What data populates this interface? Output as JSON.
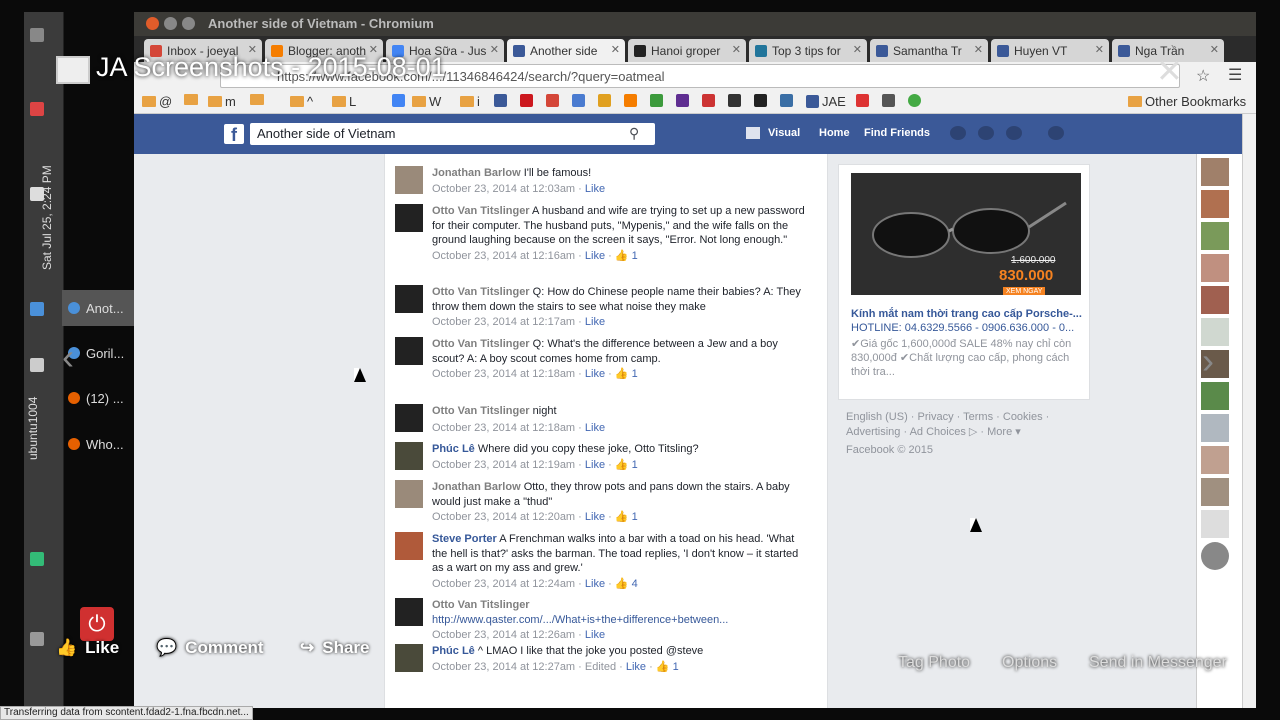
{
  "browser": {
    "window_title": "Another side of Vietnam - Chromium",
    "url": "https://www.facebook.com/.../11346846424/search/?query=oatmeal",
    "tabs": [
      {
        "label": "Inbox - joeyal",
        "color": "#d44638"
      },
      {
        "label": "Blogger: anoth",
        "color": "#f57d00"
      },
      {
        "label": "Hoa Sữa - Jus",
        "color": "#4285f4"
      },
      {
        "label": "Another side",
        "color": "#3b5998"
      },
      {
        "label": "Hanoi groper",
        "color": "#222222"
      },
      {
        "label": "Top 3 tips for",
        "color": "#21759b"
      },
      {
        "label": "Samantha Tr",
        "color": "#3b5998"
      },
      {
        "label": "Huyen VT",
        "color": "#3b5998"
      },
      {
        "label": "Nga Trần",
        "color": "#3b5998"
      }
    ],
    "bookmarks": [
      "@",
      "m",
      "^",
      "L",
      "W",
      "i",
      "JAE"
    ],
    "other_bookmarks": "Other Bookmarks",
    "status": "Transferring data from scontent.fdad2-1.fna.fbcdn.net..."
  },
  "desktop": {
    "clock": "Sat Jul 25, 2:24 PM",
    "user": "ubuntu1004",
    "tasks": [
      {
        "label": "Anot...",
        "color": "#4a90d9"
      },
      {
        "label": "Goril...",
        "color": "#4a90d9"
      },
      {
        "label": "(12) ...",
        "color": "#e66000"
      },
      {
        "label": "Who...",
        "color": "#e66000"
      }
    ]
  },
  "facebook": {
    "search_value": "Another side of Vietnam",
    "nav": {
      "visual": "Visual",
      "home": "Home",
      "find_friends": "Find Friends"
    },
    "comments": [
      {
        "author": "Jonathan Barlow",
        "verified": true,
        "text": "I'll be famous!",
        "meta": "October 23, 2014 at 12:03am",
        "like": "Like",
        "likes": ""
      },
      {
        "author": "Otto Van Titslinger",
        "verified": true,
        "text": "A husband and wife are trying to set up a new password for their computer. The husband puts, \"Mypenis,\" and the wife falls on the ground laughing because on the screen it says, \"Error. Not long enough.\"",
        "meta": "October 23, 2014 at 12:16am",
        "like": "Like",
        "likes": "1"
      },
      {
        "author": "Otto Van Titslinger",
        "verified": true,
        "text": "Q: How do Chinese people name their babies? A: They throw them down the stairs to see what noise they make",
        "meta": "October 23, 2014 at 12:17am",
        "like": "Like",
        "likes": ""
      },
      {
        "author": "Otto Van Titslinger",
        "verified": true,
        "text": "Q: What's the difference between a Jew and a boy scout? A: A boy scout comes home from camp.",
        "meta": "October 23, 2014 at 12:18am",
        "like": "Like",
        "likes": "1"
      },
      {
        "author": "Otto Van Titslinger",
        "verified": true,
        "text": "night",
        "meta": "October 23, 2014 at 12:18am",
        "like": "Like",
        "likes": ""
      },
      {
        "author": "Phúc Lê",
        "verified": false,
        "text": "Where did you copy these joke, Otto Titsling?",
        "meta": "October 23, 2014 at 12:19am",
        "like": "Like",
        "likes": "1"
      },
      {
        "author": "Jonathan Barlow",
        "verified": true,
        "text": "Otto, they throw pots and pans down the stairs. A baby would just make a \"thud\"",
        "meta": "October 23, 2014 at 12:20am",
        "like": "Like",
        "likes": "1"
      },
      {
        "author": "Steve Porter",
        "verified": false,
        "text": "A Frenchman walks into a bar with a toad on his head. 'What the hell is that?' asks the barman. The toad replies, 'I don't know – it started as a wart on my ass and grew.'",
        "meta": "October 23, 2014 at 12:24am",
        "like": "Like",
        "likes": "4"
      },
      {
        "author": "Otto Van Titslinger",
        "verified": true,
        "text": "",
        "link": "http://www.qaster.com/.../What+is+the+difference+between...",
        "meta": "October 23, 2014 at 12:26am",
        "like": "Like",
        "likes": ""
      },
      {
        "author": "Phúc Lê",
        "verified": false,
        "text": "^ LMAO I like that the joke you posted @steve",
        "meta": "October 23, 2014 at 12:27am · Edited",
        "like": "Like",
        "likes": "1"
      }
    ],
    "ad": {
      "old_price": "1.600.000",
      "new_price": "830.000",
      "cta": "XEM NGAY",
      "title": "Kính mắt nam thời trang cao cấp Porsche-...",
      "hotline": "HOTLINE: 04.6329.5566 - 0906.636.000 - 0...",
      "description": "✔Giá gốc 1,600,000đ SALE 48% nay chỉ còn 830,000đ ✔Chất lượng cao cấp, phong cách thời tra..."
    },
    "footer": {
      "links": "English (US) · Privacy · Terms · Cookies · Advertising · Ad Choices ▷ · More ▾",
      "copyright": "Facebook © 2015"
    }
  },
  "viewer": {
    "album_title": "JA Screenshots - 2015-08-01",
    "actions": {
      "like": "Like",
      "comment": "Comment",
      "share": "Share"
    },
    "right_actions": {
      "tag": "Tag Photo",
      "options": "Options",
      "send": "Send in Messenger"
    }
  },
  "colors": {
    "fb_blue": "#3b5998",
    "link_blue": "#365899",
    "ad_orange": "#f58220"
  }
}
